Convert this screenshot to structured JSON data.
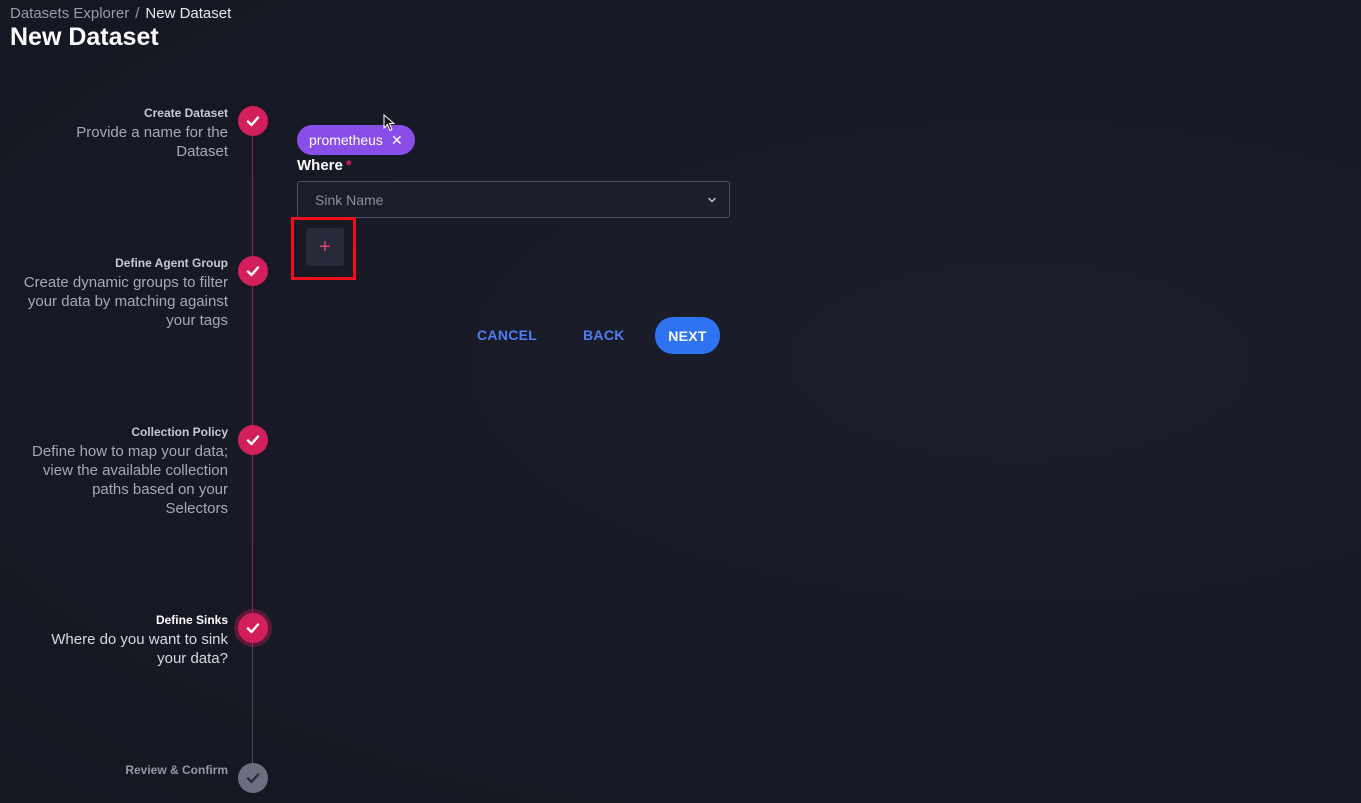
{
  "breadcrumb": {
    "parent": "Datasets Explorer",
    "separator": "/",
    "current": "New Dataset"
  },
  "page_title": "New Dataset",
  "steps": [
    {
      "title": "Create Dataset",
      "desc": "Provide a name for the Dataset",
      "status": "complete"
    },
    {
      "title": "Define Agent Group",
      "desc": "Create dynamic groups to filter your data by matching against your tags",
      "status": "complete"
    },
    {
      "title": "Collection Policy",
      "desc": "Define how to map your data; view the available collection paths based on your Selectors",
      "status": "complete"
    },
    {
      "title": "Define Sinks",
      "desc": "Where do you want to sink your data?",
      "status": "active"
    },
    {
      "title": "Review & Confirm",
      "desc": "",
      "status": "pending"
    }
  ],
  "form": {
    "chip_label": "prometheus",
    "chip_remove": "✕",
    "where_label": "Where",
    "required_mark": "*",
    "select_placeholder": "Sink Name",
    "add_label": "+"
  },
  "actions": {
    "cancel": "CANCEL",
    "back": "BACK",
    "next": "NEXT"
  },
  "colors": {
    "accent": "#d31f5b",
    "chip": "#8a4ee8",
    "primary": "#2e74f2",
    "highlight": "#f0101c"
  }
}
